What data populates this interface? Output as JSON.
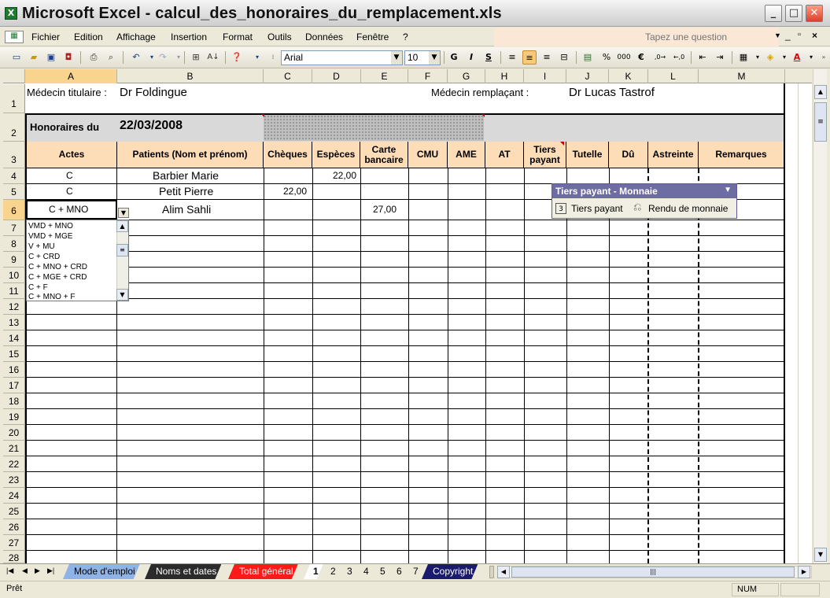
{
  "window": {
    "title": "Microsoft Excel - calcul_des_honoraires_du_remplacement.xls",
    "app_icon": "X"
  },
  "menu": {
    "items": [
      "Fichier",
      "Edition",
      "Affichage",
      "Insertion",
      "Format",
      "Outils",
      "Données",
      "Fenêtre",
      "?"
    ],
    "ask_placeholder": "Tapez une question"
  },
  "toolbar": {
    "font_name": "Arial",
    "font_size": "10"
  },
  "columns": [
    "A",
    "B",
    "C",
    "D",
    "E",
    "F",
    "G",
    "H",
    "I",
    "J",
    "K",
    "L",
    "M"
  ],
  "rows": [
    "1",
    "2",
    "3",
    "4",
    "5",
    "6",
    "7",
    "8",
    "9",
    "10",
    "11",
    "12",
    "13",
    "14",
    "15",
    "16",
    "17",
    "18",
    "19",
    "20",
    "21",
    "22",
    "23",
    "24",
    "25",
    "26",
    "27",
    "28"
  ],
  "sheet": {
    "titulaire_label": "Médecin titulaire :",
    "titulaire_value": "Dr Foldingue",
    "remplacant_label": "Médecin remplaçant :",
    "remplacant_value": "Dr Lucas Tastrof",
    "honoraires_label": "Honoraires du",
    "honoraires_date": "22/03/2008",
    "headers": {
      "actes": "Actes",
      "patients": "Patients (Nom et prénom)",
      "cheques": "Chèques",
      "especes": "Espèces",
      "carte": "Carte bancaire",
      "cmu": "CMU",
      "ame": "AME",
      "at": "AT",
      "tiers": "Tiers payant",
      "tutelle": "Tutelle",
      "du": "Dû",
      "astreinte": "Astreinte",
      "remarques": "Remarques"
    },
    "row4": {
      "acte": "C",
      "patient": "Barbier Marie",
      "especes": "22,00"
    },
    "row5": {
      "acte": "C",
      "patient": "Petit Pierre",
      "cheques": "22,00"
    },
    "row6": {
      "acte": "C + MNO",
      "patient": "Alim Sahli",
      "carte": "27,00"
    }
  },
  "dropdown_options": [
    "VMD + MNO",
    "VMD + MGE",
    "V + MU",
    "C + CRD",
    "C + MNO + CRD",
    "C + MGE + CRD",
    "C + F",
    "C + MNO + F"
  ],
  "float_toolbar": {
    "title": "Tiers payant - Monnaie",
    "btn1": "Tiers payant",
    "btn1_num": "3",
    "btn2": "Rendu de monnaie"
  },
  "tabs": {
    "mode_emploi": "Mode d'emploi",
    "noms_dates": "Noms et dates",
    "total_general": "Total général",
    "t1": "1",
    "t2": "2",
    "t3": "3",
    "t4": "4",
    "t5": "5",
    "t6": "6",
    "t7": "7",
    "copyright": "Copyright"
  },
  "status": {
    "ready": "Prêt",
    "num": "NUM"
  },
  "colors": {
    "header_fill": "#fddcb8",
    "accent_row": "#d9d9d9",
    "tab_blue": "#8fb3e6",
    "tab_black": "#2b2b2b",
    "tab_red": "#ff1a1a",
    "tab_navy": "#1b1b6e"
  }
}
